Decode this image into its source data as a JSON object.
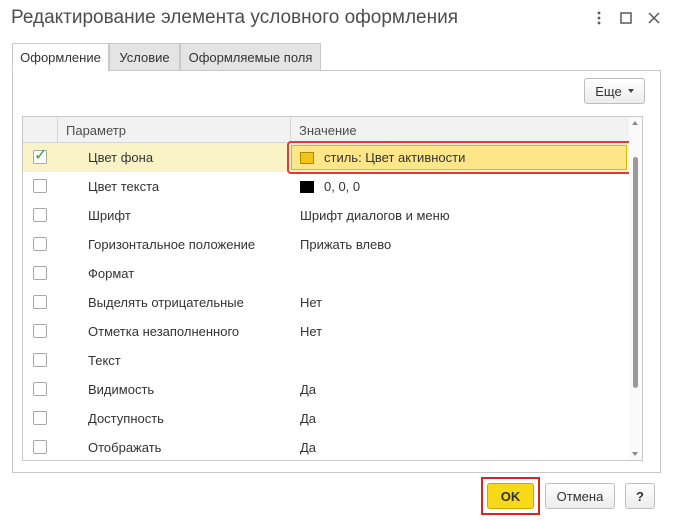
{
  "window": {
    "title": "Редактирование элемента условного оформления",
    "menu_icon": "kebab-menu-icon",
    "maximize_icon": "maximize-icon",
    "close_icon": "close-icon"
  },
  "tabs": [
    {
      "label": "Оформление",
      "active": true
    },
    {
      "label": "Условие",
      "active": false
    },
    {
      "label": "Оформляемые поля",
      "active": false
    }
  ],
  "toolbar": {
    "more_label": "Еще"
  },
  "grid": {
    "headers": {
      "parameter": "Параметр",
      "value": "Значение"
    },
    "rows": [
      {
        "checked": true,
        "parameter": "Цвет фона",
        "value": "стиль: Цвет активности",
        "swatch": "#f2c318",
        "selected": true
      },
      {
        "checked": false,
        "parameter": "Цвет текста",
        "value": "0, 0, 0",
        "swatch": "#000000"
      },
      {
        "checked": false,
        "parameter": "Шрифт",
        "value": "Шрифт диалогов и меню"
      },
      {
        "checked": false,
        "parameter": "Горизонтальное положение",
        "value": "Прижать влево"
      },
      {
        "checked": false,
        "parameter": "Формат",
        "value": ""
      },
      {
        "checked": false,
        "parameter": "Выделять отрицательные",
        "value": "Нет"
      },
      {
        "checked": false,
        "parameter": "Отметка незаполненного",
        "value": "Нет"
      },
      {
        "checked": false,
        "parameter": "Текст",
        "value": ""
      },
      {
        "checked": false,
        "parameter": "Видимость",
        "value": "Да"
      },
      {
        "checked": false,
        "parameter": "Доступность",
        "value": "Да"
      },
      {
        "checked": false,
        "parameter": "Отображать",
        "value": "Да"
      }
    ]
  },
  "footer": {
    "ok_label": "OK",
    "cancel_label": "Отмена",
    "help_label": "?"
  },
  "colors": {
    "accent_yellow": "#f7d917",
    "highlight_red": "#e53935",
    "selected_row": "#faf3c7"
  }
}
